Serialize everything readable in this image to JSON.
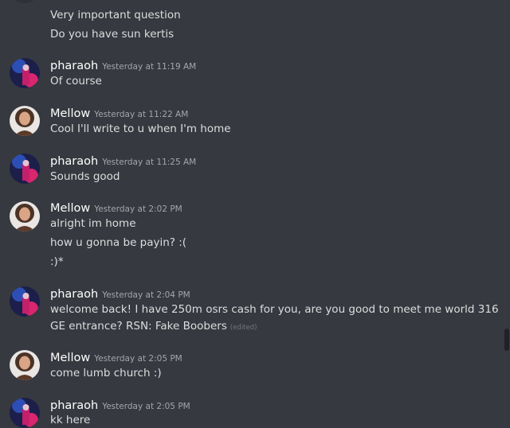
{
  "messages": [
    {
      "lines": [
        "Very important question",
        "Do you have sun kertis"
      ]
    },
    {
      "author": "pharaoh",
      "timestamp": "Yesterday at 11:19 AM",
      "lines": [
        "Of course"
      ]
    },
    {
      "author": "Mellow",
      "timestamp": "Yesterday at 11:22 AM",
      "lines": [
        "Cool I'll write to u when I'm home"
      ]
    },
    {
      "author": "pharaoh",
      "timestamp": "Yesterday at 11:25 AM",
      "lines": [
        "Sounds good"
      ]
    },
    {
      "author": "Mellow",
      "timestamp": "Yesterday at 2:02 PM",
      "lines": [
        "alright im home",
        "how u gonna be payin? :(",
        ":)*"
      ]
    },
    {
      "author": "pharaoh",
      "timestamp": "Yesterday at 2:04 PM",
      "lines": [
        "welcome back! I have 250m osrs cash for you, are you good to meet me world 316",
        "GE entrance? RSN: Fake Boobers"
      ],
      "edited_label": "(edited)"
    },
    {
      "author": "Mellow",
      "timestamp": "Yesterday at 2:05 PM",
      "lines": [
        "come lumb church :)"
      ]
    },
    {
      "author": "pharaoh",
      "timestamp": "Yesterday at 2:05 PM",
      "lines": [
        "kk here"
      ]
    }
  ],
  "avatars": {
    "pharaoh": "neon-figure-avatar",
    "Mellow": "woman-portrait-avatar"
  }
}
